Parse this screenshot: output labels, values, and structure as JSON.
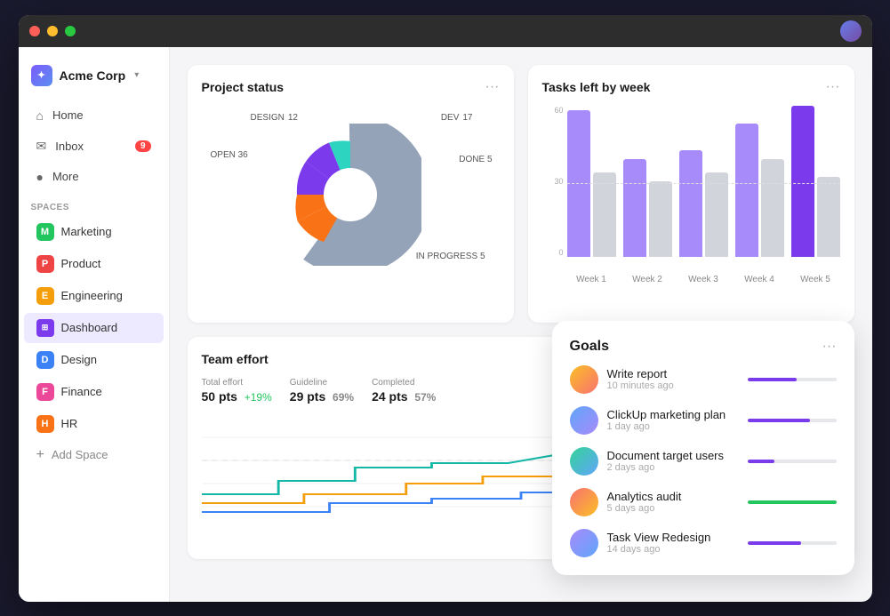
{
  "titleBar": {
    "trafficLights": [
      "red",
      "yellow",
      "green"
    ]
  },
  "sidebar": {
    "logo": {
      "text": "Acme Corp",
      "caret": "▾"
    },
    "navItems": [
      {
        "label": "Home",
        "icon": "🏠"
      },
      {
        "label": "Inbox",
        "icon": "✉",
        "badge": "9"
      },
      {
        "label": "More",
        "icon": "●"
      }
    ],
    "spacesHeader": "Spaces",
    "spaces": [
      {
        "label": "Marketing",
        "initial": "M",
        "colorClass": "m"
      },
      {
        "label": "Product",
        "initial": "P",
        "colorClass": "p"
      },
      {
        "label": "Engineering",
        "initial": "E",
        "colorClass": "e"
      },
      {
        "label": "Dashboard",
        "initial": "⊞",
        "colorClass": "dashboard",
        "active": true
      },
      {
        "label": "Design",
        "initial": "D",
        "colorClass": "d"
      },
      {
        "label": "Finance",
        "initial": "F",
        "colorClass": "f"
      },
      {
        "label": "HR",
        "initial": "H",
        "colorClass": "h"
      }
    ],
    "addSpace": "Add Space"
  },
  "projectStatus": {
    "title": "Project status",
    "menuLabel": "···",
    "segments": [
      {
        "label": "DEV",
        "value": 17,
        "color": "#7c3aed",
        "pct": 22
      },
      {
        "label": "DONE",
        "value": 5,
        "color": "#2dd4bf",
        "pct": 7
      },
      {
        "label": "IN PROGRESS",
        "value": 5,
        "color": "#3b82f6",
        "pct": 7
      },
      {
        "label": "OPEN",
        "value": 36,
        "color": "#94a3b8",
        "pct": 47
      },
      {
        "label": "DESIGN",
        "value": 12,
        "color": "#f97316",
        "pct": 15
      }
    ]
  },
  "tasksLeftByWeek": {
    "title": "Tasks left by week",
    "menuLabel": "···",
    "yLabels": [
      "60",
      "",
      "30",
      "",
      "0"
    ],
    "weeks": [
      {
        "label": "Week 1",
        "purple": 165,
        "gray": 120
      },
      {
        "label": "Week 2",
        "purple": 110,
        "gray": 100
      },
      {
        "label": "Week 3",
        "purple": 125,
        "gray": 110
      },
      {
        "label": "Week 4",
        "purple": 155,
        "gray": 120
      },
      {
        "label": "Week 5",
        "purple": 175,
        "gray": 100
      }
    ],
    "dashedLineY": 46
  },
  "teamEffort": {
    "title": "Team effort",
    "menuLabel": "···",
    "stats": [
      {
        "label": "Total effort",
        "value": "50 pts",
        "change": "+19%",
        "changeColor": "#22c55e"
      },
      {
        "label": "Guideline",
        "value": "29 pts",
        "pct": "69%"
      },
      {
        "label": "Completed",
        "value": "24 pts",
        "pct": "57%"
      }
    ]
  },
  "goals": {
    "title": "Goals",
    "menuLabel": "···",
    "items": [
      {
        "name": "Write report",
        "time": "10 minutes ago",
        "avatarClass": "a1",
        "progress": 55,
        "progressColor": "prog-purple"
      },
      {
        "name": "ClickUp marketing plan",
        "time": "1 day ago",
        "avatarClass": "a2",
        "progress": 70,
        "progressColor": "prog-purple"
      },
      {
        "name": "Document target users",
        "time": "2 days ago",
        "avatarClass": "a3",
        "progress": 30,
        "progressColor": "prog-purple"
      },
      {
        "name": "Analytics audit",
        "time": "5 days ago",
        "avatarClass": "a4",
        "progress": 100,
        "progressColor": "prog-green"
      },
      {
        "name": "Task View Redesign",
        "time": "14 days ago",
        "avatarClass": "a5",
        "progress": 60,
        "progressColor": "prog-purple"
      }
    ]
  }
}
